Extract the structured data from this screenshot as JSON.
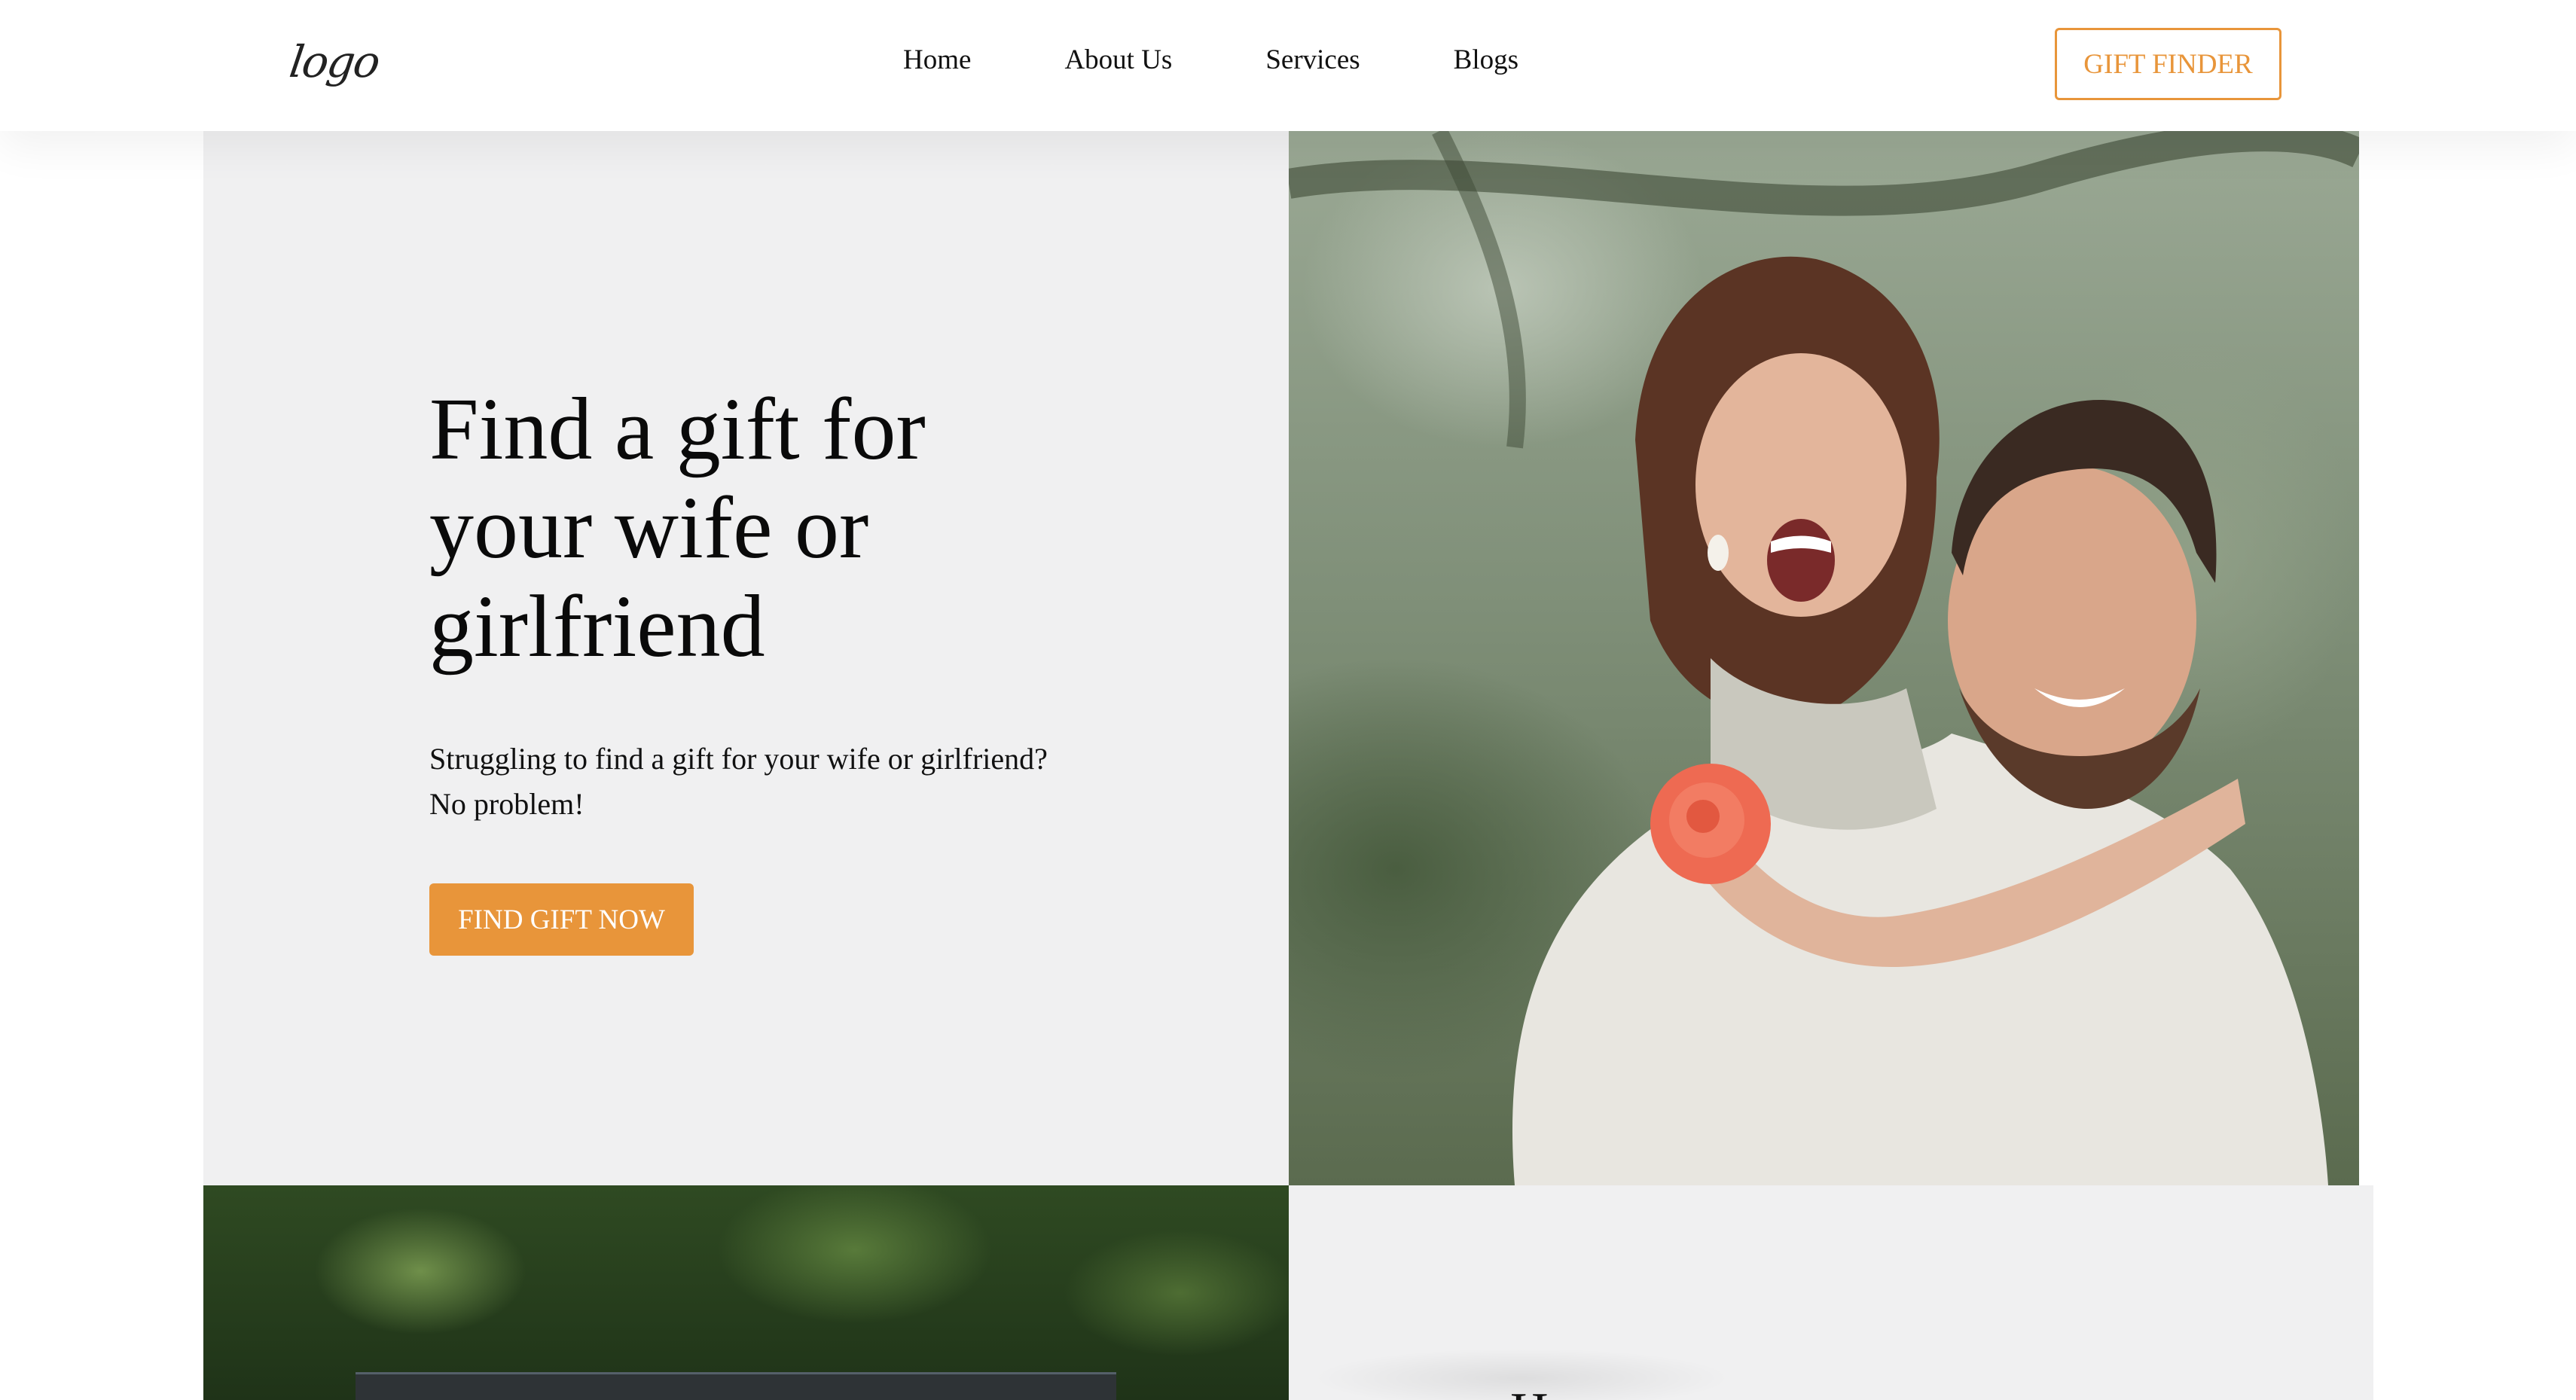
{
  "header": {
    "logo_text": "logo",
    "nav": [
      {
        "label": "Home"
      },
      {
        "label": "About Us"
      },
      {
        "label": "Services"
      },
      {
        "label": "Blogs"
      }
    ],
    "cta_label": "GIFT FINDER"
  },
  "hero": {
    "title": "Find a gift for your wife or girlfriend",
    "subtitle_line1": "Struggling to find a gift for your wife or girlfriend?",
    "subtitle_line2": "No problem!",
    "button_label": "FIND GIFT NOW"
  },
  "lower": {
    "heading_partial": "H"
  },
  "colors": {
    "accent": "#e8953a",
    "panel_bg": "#f0f0f1",
    "text": "#111111"
  }
}
